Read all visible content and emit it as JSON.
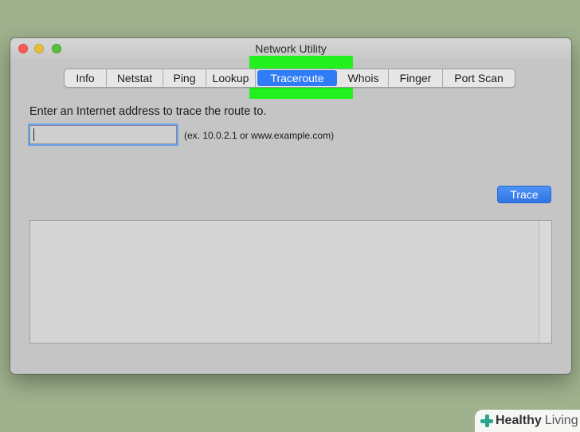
{
  "window": {
    "title": "Network Utility"
  },
  "tabs": [
    {
      "label": "Info",
      "selected": false
    },
    {
      "label": "Netstat",
      "selected": false
    },
    {
      "label": "Ping",
      "selected": false
    },
    {
      "label": "Lookup",
      "selected": false
    },
    {
      "label": "Traceroute",
      "selected": true
    },
    {
      "label": "Whois",
      "selected": false
    },
    {
      "label": "Finger",
      "selected": false
    },
    {
      "label": "Port Scan",
      "selected": false
    }
  ],
  "traceroute": {
    "prompt": "Enter an Internet address to trace the route to.",
    "address_value": "",
    "example_hint": "(ex. 10.0.2.1 or www.example.com)",
    "trace_button_label": "Trace",
    "output_text": ""
  },
  "watermark": {
    "brand_bold": "Healthy",
    "brand_light": "Living",
    "icon": "plus-cross-icon"
  },
  "colors": {
    "desktop_background": "#9fb18d",
    "selected_tab": "#2f7cf6",
    "highlight": "#22f01f",
    "trace_button": "#3a82f0"
  }
}
